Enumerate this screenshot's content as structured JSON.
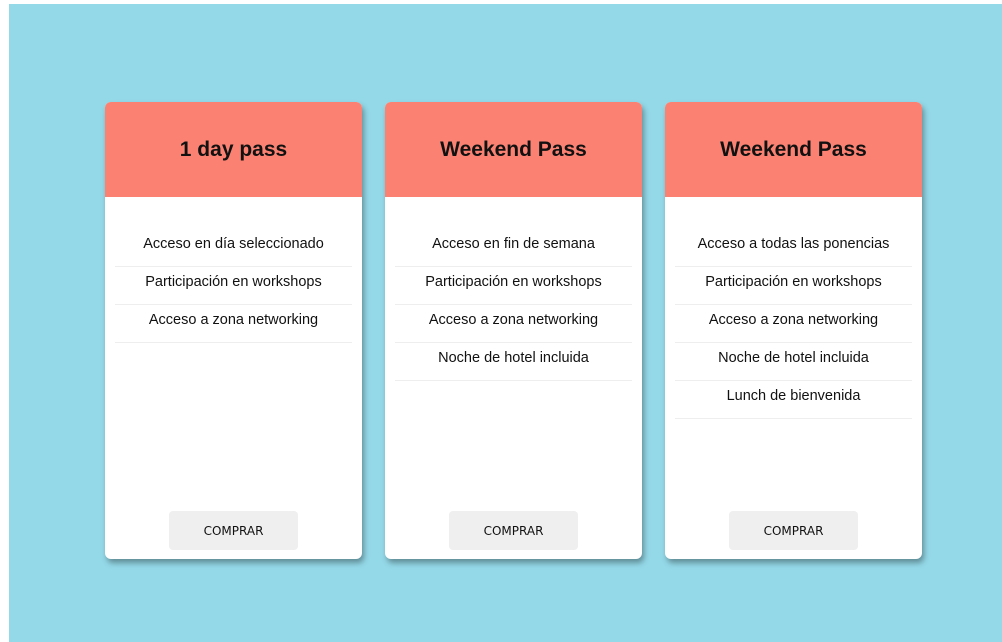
{
  "cards": [
    {
      "title": "1 day pass",
      "features": [
        "Acceso en día seleccionado",
        "Participación en workshops",
        "Acceso a zona networking"
      ],
      "button_label": "COMPRAR"
    },
    {
      "title": "Weekend Pass",
      "features": [
        "Acceso en fin de semana",
        "Participación en workshops",
        "Acceso a zona networking",
        "Noche de hotel incluida"
      ],
      "button_label": "COMPRAR"
    },
    {
      "title": "Weekend Pass",
      "features": [
        "Acceso a todas las ponencias",
        "Participación en workshops",
        "Acceso a zona networking",
        "Noche de hotel incluida",
        "Lunch de bienvenida"
      ],
      "button_label": "COMPRAR"
    }
  ],
  "colors": {
    "background": "#94d9e8",
    "card_header": "#fb8272",
    "card_body": "#ffffff",
    "button": "#efefef"
  }
}
